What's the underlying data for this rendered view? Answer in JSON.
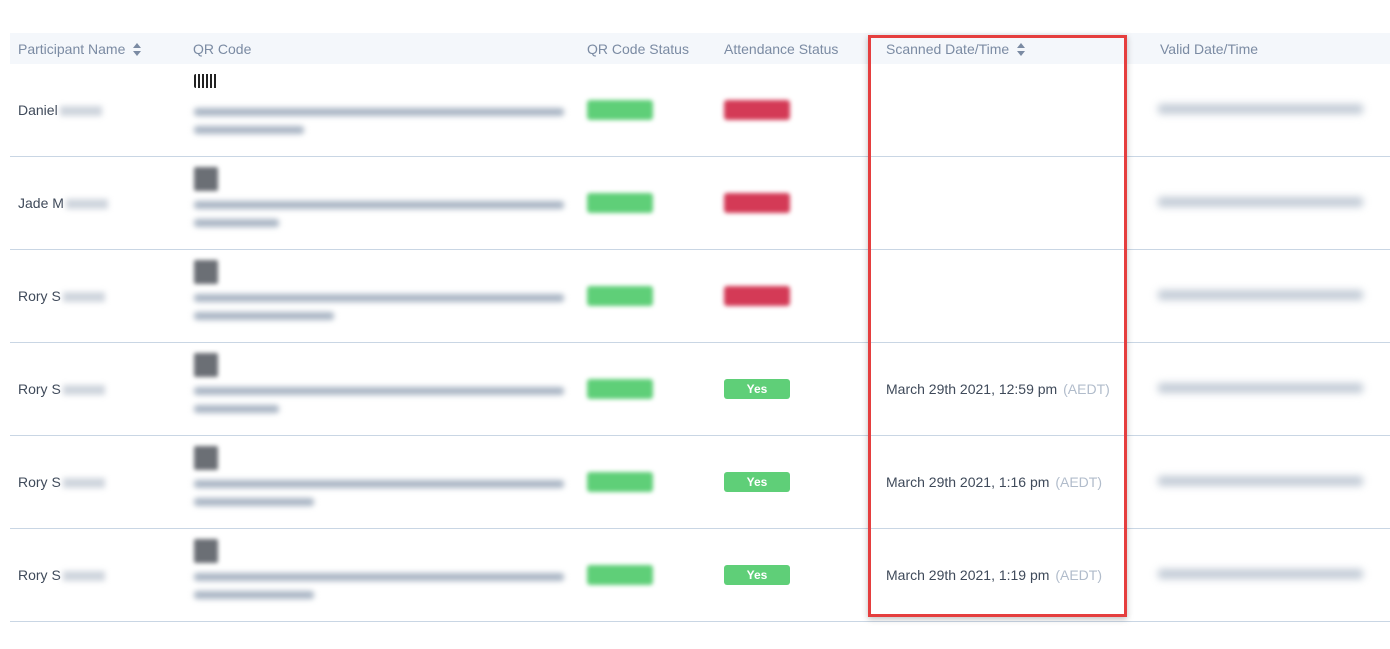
{
  "table": {
    "headers": {
      "participant_name": "Participant Name",
      "qr_code": "QR Code",
      "qr_code_status": "QR Code Status",
      "attendance_status": "Attendance Status",
      "scanned_datetime": "Scanned Date/Time",
      "valid_datetime": "Valid Date/Time"
    },
    "rows": [
      {
        "name": "Daniel",
        "attendance": "",
        "scanned": "",
        "tz": ""
      },
      {
        "name": "Jade M",
        "attendance": "",
        "scanned": "",
        "tz": ""
      },
      {
        "name": "Rory S",
        "attendance": "",
        "scanned": "",
        "tz": ""
      },
      {
        "name": "Rory S",
        "attendance": "Yes",
        "scanned": "March 29th 2021, 12:59 pm",
        "tz": "(AEDT)"
      },
      {
        "name": "Rory S",
        "attendance": "Yes",
        "scanned": "March 29th 2021, 1:16 pm",
        "tz": "(AEDT)"
      },
      {
        "name": "Rory S",
        "attendance": "Yes",
        "scanned": "March 29th 2021, 1:19 pm",
        "tz": "(AEDT)"
      }
    ]
  },
  "colors": {
    "highlight_border": "#e53e3e",
    "valid_green": "#5fcf78",
    "no_red": "#d43a56"
  }
}
